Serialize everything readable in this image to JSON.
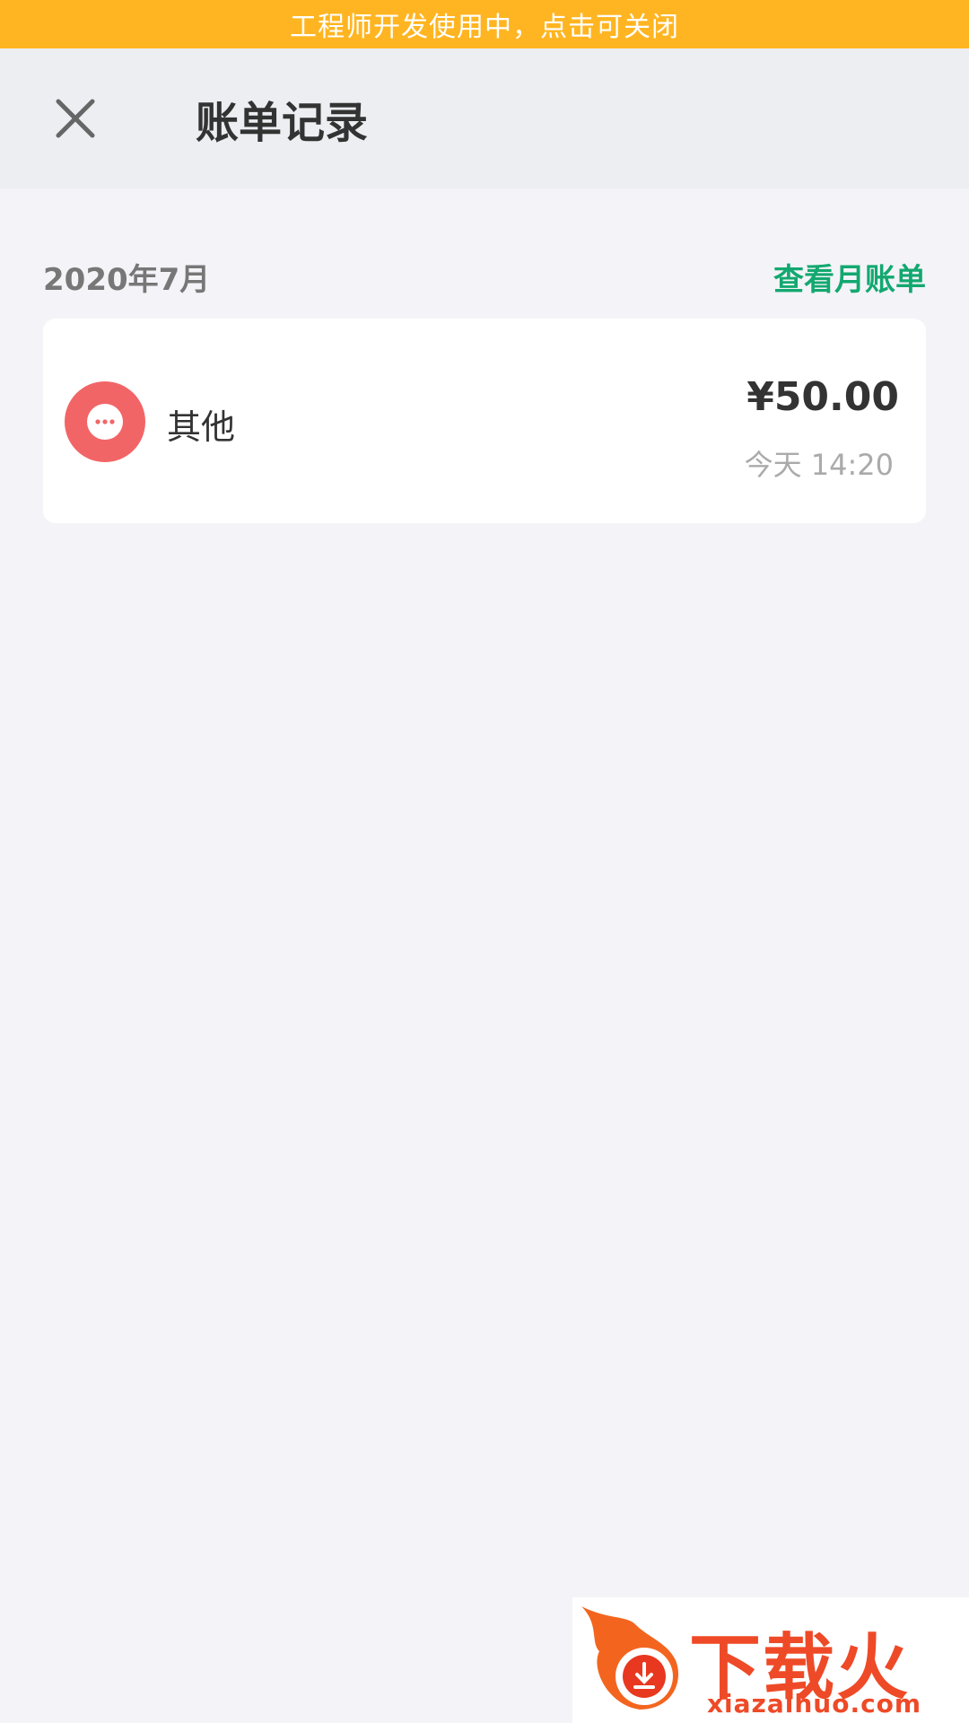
{
  "banner": {
    "text": "工程师开发使用中，点击可关闭",
    "color": "#ffb521"
  },
  "header": {
    "close_icon": "close-icon",
    "title": "账单记录"
  },
  "month_group": {
    "label": "2020年7月",
    "link": "查看月账单",
    "link_color": "#13a870"
  },
  "records": [
    {
      "category": "其他",
      "icon": "more-dots-icon",
      "icon_color": "#f26566",
      "amount": "¥50.00",
      "time": "今天 14:20"
    }
  ],
  "watermark": {
    "text": "下载火",
    "url": "xiazaihuo.com"
  }
}
